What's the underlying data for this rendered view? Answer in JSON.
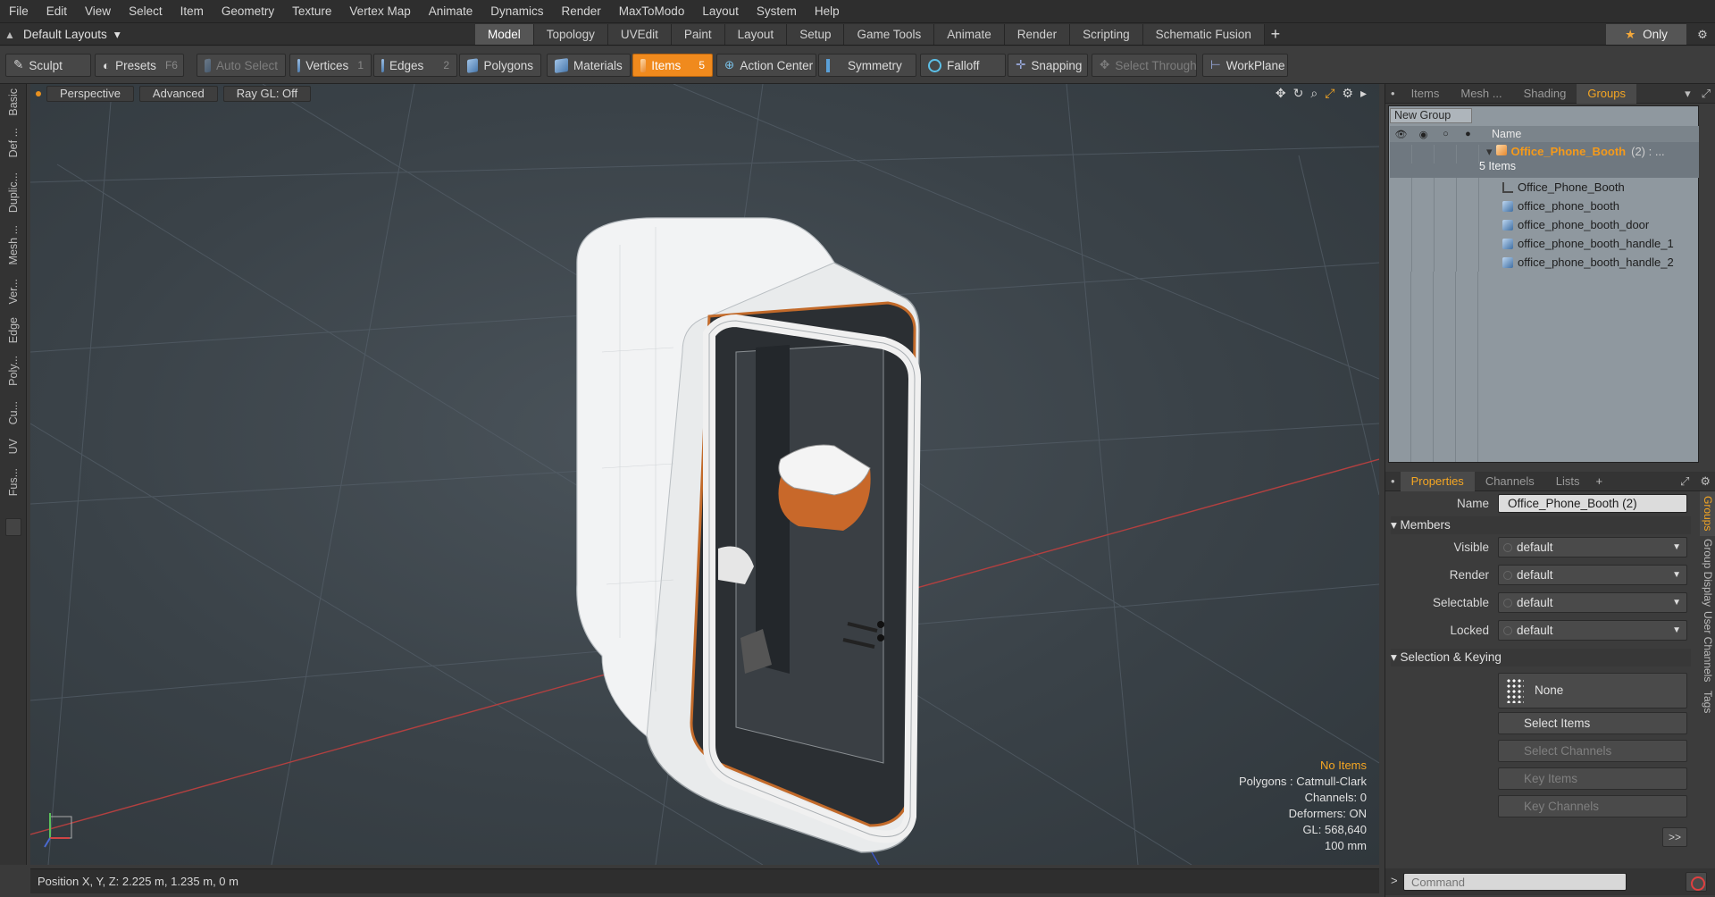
{
  "menu": [
    "File",
    "Edit",
    "View",
    "Select",
    "Item",
    "Geometry",
    "Texture",
    "Vertex Map",
    "Animate",
    "Dynamics",
    "Render",
    "MaxToModo",
    "Layout",
    "System",
    "Help"
  ],
  "layout_selector": "Default Layouts",
  "tabs": [
    "Model",
    "Topology",
    "UVEdit",
    "Paint",
    "Layout",
    "Setup",
    "Game Tools",
    "Animate",
    "Render",
    "Scripting",
    "Schematic Fusion"
  ],
  "active_tab": "Model",
  "only_label": "Only",
  "toolbar": {
    "sculpt": "Sculpt",
    "presets": "Presets",
    "presets_key": "F6",
    "auto_select": "Auto Select",
    "vertices": "Vertices",
    "vertices_key": "1",
    "edges": "Edges",
    "edges_key": "2",
    "polygons": "Polygons",
    "materials": "Materials",
    "items": "Items",
    "items_key": "5",
    "action_center": "Action Center",
    "symmetry": "Symmetry",
    "falloff": "Falloff",
    "snapping": "Snapping",
    "select_through": "Select Through",
    "workplane": "WorkPlane"
  },
  "left_tabs": [
    "Basic",
    "Def ...",
    "Duplic...",
    "Mesh ...",
    "Ver...",
    "Edge",
    "Poly...",
    "Cu...",
    "UV",
    "Fus..."
  ],
  "viewport": {
    "view": "Perspective",
    "shading": "Advanced",
    "raygl": "Ray GL: Off",
    "stats": {
      "selection": "No Items",
      "polygons": "Polygons : Catmull-Clark",
      "channels": "Channels: 0",
      "deformers": "Deformers: ON",
      "gl": "GL: 568,640",
      "scale": "100 mm"
    }
  },
  "status": "Position X, Y, Z:   2.225 m, 1.235 m, 0 m",
  "groups_panel": {
    "tabs": [
      "Items",
      "Mesh ...",
      "Shading",
      "Groups"
    ],
    "active": "Groups",
    "new_group": "New Group",
    "name_header": "Name",
    "group_name": "Office_Phone_Booth",
    "group_count": "(2) : ...",
    "group_items": "5 Items",
    "children": [
      "Office_Phone_Booth",
      "office_phone_booth",
      "office_phone_booth_door",
      "office_phone_booth_handle_1",
      "office_phone_booth_handle_2"
    ]
  },
  "properties": {
    "tabs": [
      "Properties",
      "Channels",
      "Lists"
    ],
    "active": "Properties",
    "side_tabs": [
      "Groups",
      "Group Display",
      "User Channels",
      "Tags"
    ],
    "name_label": "Name",
    "name_value": "Office_Phone_Booth (2)",
    "members_section": "Members",
    "visible_label": "Visible",
    "visible_value": "default",
    "render_label": "Render",
    "render_value": "default",
    "selectable_label": "Selectable",
    "selectable_value": "default",
    "locked_label": "Locked",
    "locked_value": "default",
    "selection_section": "Selection & Keying",
    "none_btn": "None",
    "select_items": "Select Items",
    "select_channels": "Select Channels",
    "key_items": "Key Items",
    "key_channels": "Key Channels",
    "more": ">>"
  },
  "command_placeholder": "Command",
  "colors": {
    "accent": "#f08a1d",
    "group_name": "#f59a1a",
    "panel": "#3c3c3c"
  }
}
